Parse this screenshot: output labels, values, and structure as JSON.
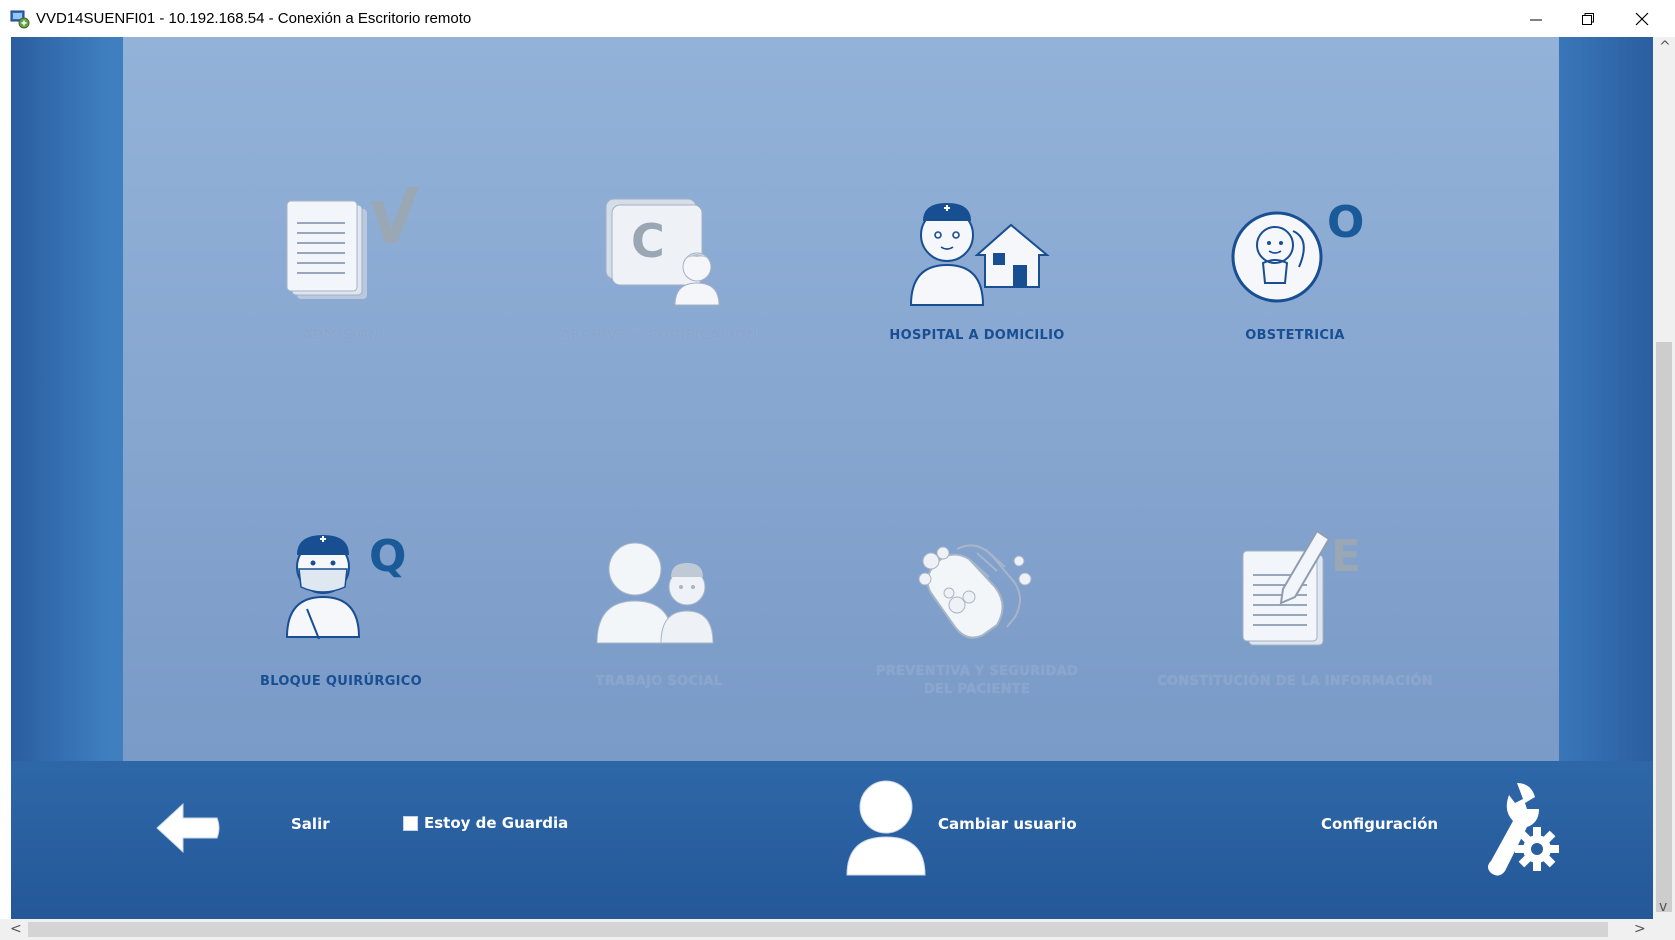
{
  "window": {
    "title": "VVD14SUENFI01 - 10.192.168.54 - Conexión a Escritorio remoto",
    "icon": "remote-desktop-icon",
    "controls": {
      "minimize": "—",
      "restore": "❐",
      "close": "✕"
    }
  },
  "modules": [
    {
      "label": "ADMISIÓN",
      "icon": "documents-check-icon",
      "enabled": false,
      "letter": "✓"
    },
    {
      "label": "ARCHIVO Y CODIFICACIÓN",
      "icon": "archive-coding-icon",
      "enabled": false,
      "letter": "C"
    },
    {
      "label": "HOSPITAL A DOMICILIO",
      "icon": "nurse-home-icon",
      "enabled": true,
      "letter": ""
    },
    {
      "label": "OBSTETRICIA",
      "icon": "baby-icon",
      "enabled": true,
      "letter": "O"
    },
    {
      "label": "BLOQUE QUIRÚRGICO",
      "icon": "surgeon-icon",
      "enabled": true,
      "letter": "Q"
    },
    {
      "label": "TRABAJO SOCIAL",
      "icon": "social-work-icon",
      "enabled": false,
      "letter": ""
    },
    {
      "label_line1": "PREVENTIVA Y SEGURIDAD",
      "label_line2": "DEL PACIENTE",
      "icon": "hand-washing-icon",
      "enabled": false,
      "letter": ""
    },
    {
      "label": "CONSTITUCIÓN DE LA INFORMACIÓN",
      "icon": "document-pen-icon",
      "enabled": false,
      "letter": "E"
    }
  ],
  "bottom": {
    "exit_label": "Salir",
    "on_call_label": "Estoy de Guardia",
    "on_call_checked": false,
    "change_user_label": "Cambiar usuario",
    "config_label": "Configuración"
  },
  "scrollbars": {
    "up": "^",
    "down": "v",
    "left": "<",
    "right": ">"
  },
  "colors": {
    "panel": "#8aa9d2",
    "frame": "#3a78ba",
    "enabled_label": "#184f93",
    "disabled_label": "#8aa6cf",
    "accent_letter": "#1a5a98"
  }
}
